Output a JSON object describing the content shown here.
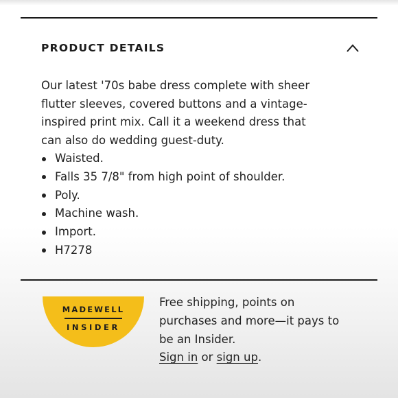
{
  "product_details": {
    "title": "PRODUCT DETAILS",
    "toggle_icon": "chevron-up-icon",
    "description_lines": [
      "Our latest '70s babe dress complete with sheer",
      "flutter sleeves, covered buttons and a vintage-",
      "inspired print mix. Call it a weekend dress that",
      "can also do wedding guest-duty."
    ],
    "bullets": [
      "Waisted.",
      "Falls 35 7/8\" from high point of shoulder.",
      "Poly.",
      "Machine wash.",
      "Import.",
      "H7278"
    ]
  },
  "insider": {
    "badge_line1": "MADEWELL",
    "badge_line2": "INSIDER",
    "badge_color": "#f4be1a",
    "promo_lines": [
      "Free shipping, points on",
      "purchases and more—it pays to",
      "be an Insider."
    ],
    "sign_in_label": "Sign in",
    "or_text": " or ",
    "sign_up_label": "sign up",
    "period": "."
  }
}
